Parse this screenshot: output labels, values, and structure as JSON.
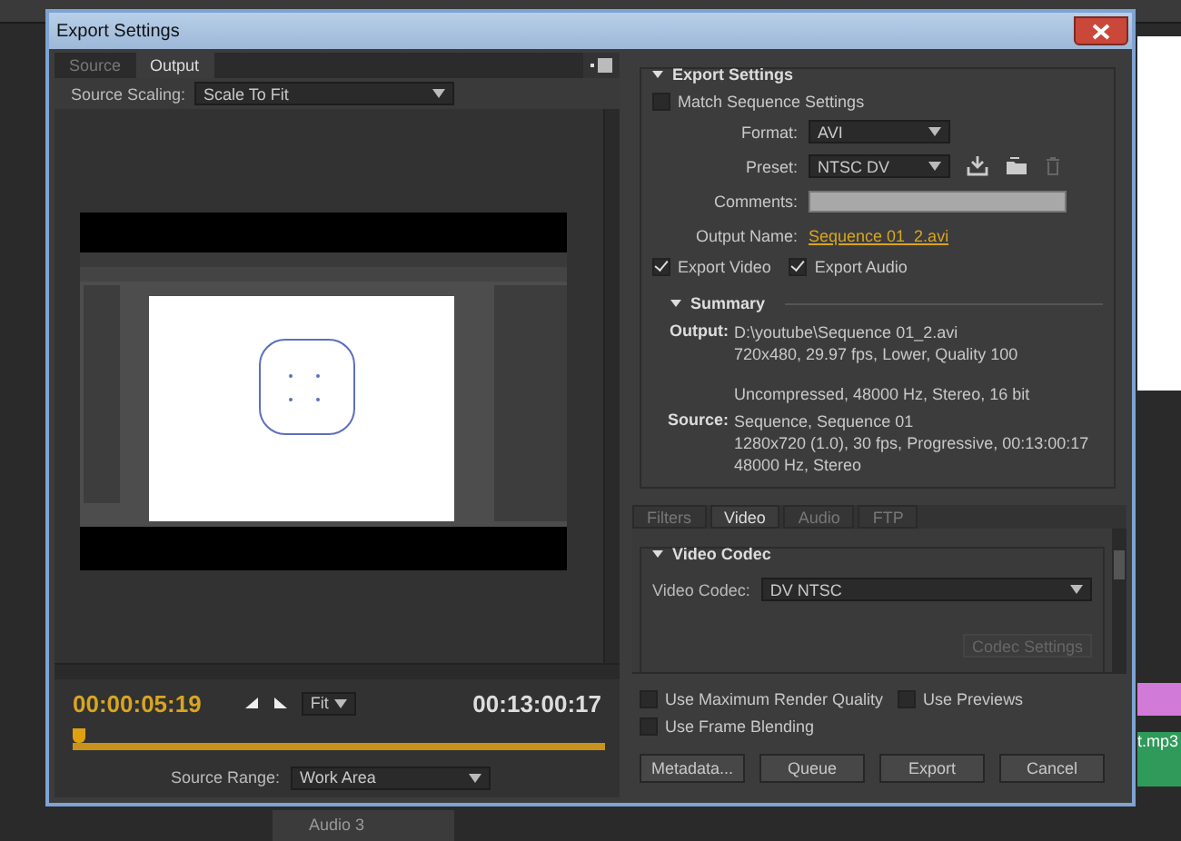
{
  "dialog": {
    "title": "Export Settings"
  },
  "left_tabs": [
    {
      "label": "Source",
      "selected": false
    },
    {
      "label": "Output",
      "selected": true
    }
  ],
  "source_scaling": {
    "label": "Source Scaling:",
    "value": "Scale To Fit"
  },
  "preview": {
    "timecode": "00:00:05:19",
    "zoom": "Fit",
    "duration": "00:13:00:17",
    "level": 0.0
  },
  "source_range": {
    "label": "Source Range:",
    "value": "Work Area"
  },
  "export_settings": {
    "heading": "Export Settings",
    "expanded": true,
    "match_sequence": {
      "label": "Match Sequence Settings",
      "checked": false
    },
    "fields": [
      {
        "kind": "dropdown",
        "label": "Format:",
        "value": "AVI"
      },
      {
        "kind": "preset",
        "label": "Preset:",
        "value": "NTSC DV"
      },
      {
        "kind": "text",
        "label": "Comments:"
      },
      {
        "kind": "link",
        "label": "Output Name:",
        "value": "Sequence 01_2.avi"
      }
    ],
    "exports": [
      {
        "label": "Export Video",
        "checked": true
      },
      {
        "label": "Export Audio",
        "checked": true
      }
    ],
    "summary": {
      "heading": "Summary",
      "expanded": true,
      "entries": [
        {
          "label": "Output:",
          "groups": [
            [
              "D:\\youtube\\Sequence 01_2.avi",
              "720x480, 29.97 fps, Lower, Quality 100"
            ],
            [
              "Uncompressed, 48000 Hz, Stereo, 16 bit"
            ]
          ]
        },
        {
          "label": "Source:",
          "groups": [
            [
              "Sequence, Sequence 01",
              "1280x720 (1.0), 30 fps, Progressive, 00:13:00:17",
              "48000 Hz, Stereo"
            ]
          ]
        }
      ]
    }
  },
  "right_tabs": [
    {
      "label": "Filters",
      "selected": false
    },
    {
      "label": "Video",
      "selected": true
    },
    {
      "label": "Audio",
      "selected": false
    },
    {
      "label": "FTP",
      "selected": false
    }
  ],
  "video_codec": {
    "heading": "Video Codec",
    "expanded": true,
    "label": "Video Codec:",
    "value": "DV NTSC",
    "button": "Codec Settings",
    "button_disabled": true
  },
  "options": [
    {
      "label": "Use Maximum Render Quality",
      "checked": false
    },
    {
      "label": "Use Previews",
      "checked": false
    },
    {
      "label": "Use Frame Blending",
      "checked": false
    }
  ],
  "buttons": [
    "Metadata...",
    "Queue",
    "Export",
    "Cancel"
  ],
  "background": {
    "track": "Audio 3",
    "clip": "t.mp3"
  }
}
